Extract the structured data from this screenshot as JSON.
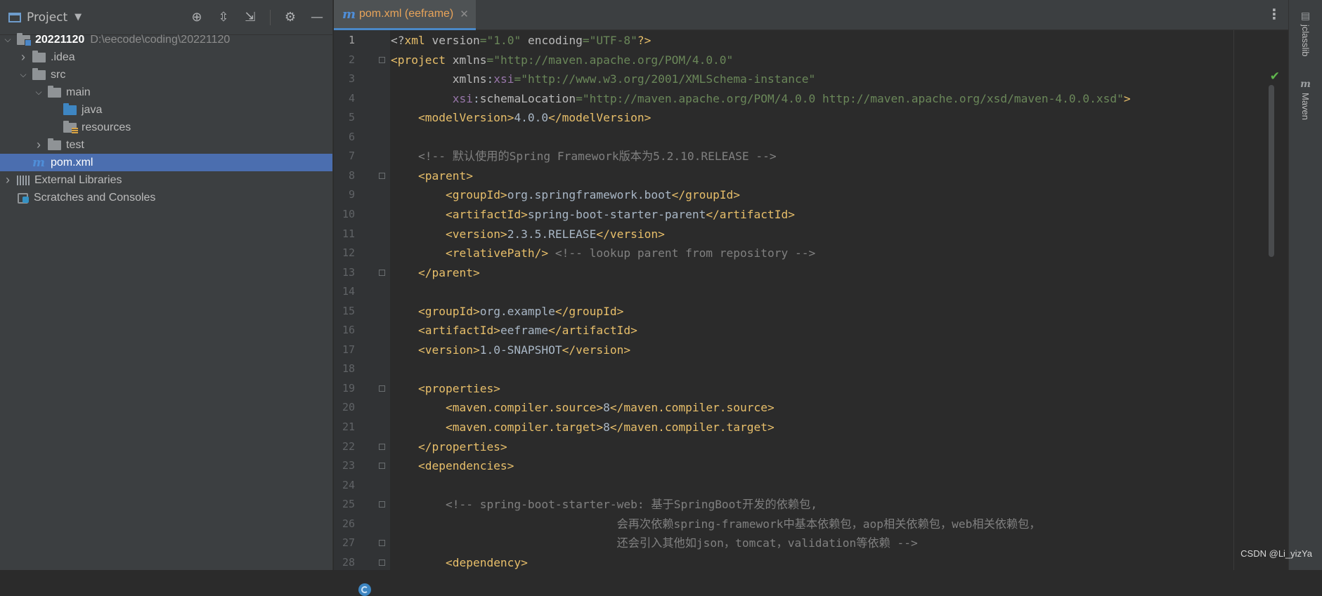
{
  "project_panel": {
    "title": "Project",
    "tree": [
      {
        "label": "20221120",
        "hint": "D:\\eecode\\coding\\20221120",
        "depth": 0,
        "expanded": true,
        "icon": "module-folder-icon"
      },
      {
        "label": ".idea",
        "depth": 1,
        "expanded": false,
        "icon": "folder-icon"
      },
      {
        "label": "src",
        "depth": 1,
        "expanded": true,
        "icon": "folder-icon"
      },
      {
        "label": "main",
        "depth": 2,
        "expanded": true,
        "icon": "folder-icon"
      },
      {
        "label": "java",
        "depth": 3,
        "expanded": null,
        "icon": "source-folder-icon"
      },
      {
        "label": "resources",
        "depth": 3,
        "expanded": null,
        "icon": "resources-folder-icon"
      },
      {
        "label": "test",
        "depth": 2,
        "expanded": false,
        "icon": "folder-icon"
      },
      {
        "label": "pom.xml",
        "depth": 1,
        "expanded": null,
        "icon": "maven-icon",
        "selected": true
      },
      {
        "label": "External Libraries",
        "depth": 0,
        "expanded": false,
        "icon": "library-icon"
      },
      {
        "label": "Scratches and Consoles",
        "depth": 0,
        "expanded": null,
        "icon": "scratches-icon"
      }
    ]
  },
  "editor": {
    "tab_label": "pom.xml (eeframe)",
    "current_line": 1,
    "line_numbers": [
      "1",
      "2",
      "3",
      "4",
      "5",
      "6",
      "7",
      "8",
      "9",
      "10",
      "11",
      "12",
      "13",
      "14",
      "15",
      "16",
      "17",
      "18",
      "19",
      "20",
      "21",
      "22",
      "23",
      "24",
      "25",
      "26",
      "27",
      "28"
    ],
    "code": [
      [
        [
          "b",
          "<?"
        ],
        [
          "tag",
          "xml "
        ],
        [
          "attr",
          "version"
        ],
        [
          "val",
          "=\"1.0\" "
        ],
        [
          "attr",
          "encoding"
        ],
        [
          "val",
          "=\"UTF-8\""
        ],
        [
          "tag",
          "?>"
        ]
      ],
      [
        [
          "tag",
          "<project "
        ],
        [
          "attr",
          "xmlns"
        ],
        [
          "val",
          "=\"http://maven.apache.org/POM/4.0.0\""
        ]
      ],
      [
        [
          "txt",
          "         "
        ],
        [
          "attr",
          "xmlns"
        ],
        [
          "txt",
          ":"
        ],
        [
          "ns",
          "xsi"
        ],
        [
          "val",
          "=\"http://www.w3.org/2001/XMLSchema-instance\""
        ]
      ],
      [
        [
          "txt",
          "         "
        ],
        [
          "ns",
          "xsi"
        ],
        [
          "txt",
          ":"
        ],
        [
          "attr",
          "schemaLocation"
        ],
        [
          "val",
          "=\"http://maven.apache.org/POM/4.0.0 http://maven.apache.org/xsd/maven-4.0.0.xsd\""
        ],
        [
          "tag",
          ">"
        ]
      ],
      [
        [
          "txt",
          "    "
        ],
        [
          "tag",
          "<modelVersion>"
        ],
        [
          "txt",
          "4.0.0"
        ],
        [
          "tag",
          "</modelVersion>"
        ]
      ],
      [],
      [
        [
          "txt",
          "    "
        ],
        [
          "cmt",
          "<!-- 默认使用的Spring Framework版本为5.2.10.RELEASE -->"
        ]
      ],
      [
        [
          "txt",
          "    "
        ],
        [
          "tag",
          "<parent>"
        ]
      ],
      [
        [
          "txt",
          "        "
        ],
        [
          "tag",
          "<groupId>"
        ],
        [
          "txt",
          "org.springframework.boot"
        ],
        [
          "tag",
          "</groupId>"
        ]
      ],
      [
        [
          "txt",
          "        "
        ],
        [
          "tag",
          "<artifactId>"
        ],
        [
          "txt",
          "spring-boot-starter-parent"
        ],
        [
          "tag",
          "</artifactId>"
        ]
      ],
      [
        [
          "txt",
          "        "
        ],
        [
          "tag",
          "<version>"
        ],
        [
          "txt",
          "2.3.5.RELEASE"
        ],
        [
          "tag",
          "</version>"
        ]
      ],
      [
        [
          "txt",
          "        "
        ],
        [
          "tag",
          "<relativePath/>"
        ],
        [
          "txt",
          " "
        ],
        [
          "cmt",
          "<!-- lookup parent from repository -->"
        ]
      ],
      [
        [
          "txt",
          "    "
        ],
        [
          "tag",
          "</parent>"
        ]
      ],
      [],
      [
        [
          "txt",
          "    "
        ],
        [
          "tag",
          "<groupId>"
        ],
        [
          "txt",
          "org.example"
        ],
        [
          "tag",
          "</groupId>"
        ]
      ],
      [
        [
          "txt",
          "    "
        ],
        [
          "tag",
          "<artifactId>"
        ],
        [
          "txt",
          "eeframe"
        ],
        [
          "tag",
          "</artifactId>"
        ]
      ],
      [
        [
          "txt",
          "    "
        ],
        [
          "tag",
          "<version>"
        ],
        [
          "txt",
          "1.0-SNAPSHOT"
        ],
        [
          "tag",
          "</version>"
        ]
      ],
      [],
      [
        [
          "txt",
          "    "
        ],
        [
          "tag",
          "<properties>"
        ]
      ],
      [
        [
          "txt",
          "        "
        ],
        [
          "tag",
          "<maven.compiler.source>"
        ],
        [
          "txt",
          "8"
        ],
        [
          "tag",
          "</maven.compiler.source>"
        ]
      ],
      [
        [
          "txt",
          "        "
        ],
        [
          "tag",
          "<maven.compiler.target>"
        ],
        [
          "txt",
          "8"
        ],
        [
          "tag",
          "</maven.compiler.target>"
        ]
      ],
      [
        [
          "txt",
          "    "
        ],
        [
          "tag",
          "</properties>"
        ]
      ],
      [
        [
          "txt",
          "    "
        ],
        [
          "tag",
          "<dependencies>"
        ]
      ],
      [],
      [
        [
          "txt",
          "        "
        ],
        [
          "cmt",
          "<!-- spring-boot-starter-web: 基于SpringBoot开发的依赖包,"
        ]
      ],
      [
        [
          "txt",
          "                                 "
        ],
        [
          "cmt",
          "会再次依赖spring-framework中基本依赖包，aop相关依赖包，web相关依赖包，"
        ]
      ],
      [
        [
          "txt",
          "                                 "
        ],
        [
          "cmt",
          "还会引入其他如json，tomcat，validation等依赖 -->"
        ]
      ],
      [
        [
          "txt",
          "        "
        ],
        [
          "tag",
          "<dependency>"
        ]
      ]
    ]
  },
  "right_strip": {
    "items": [
      {
        "label": "jclasslib",
        "icon": "jclasslib-icon"
      },
      {
        "label": "Maven",
        "icon": "maven-strip-icon"
      }
    ]
  },
  "watermark": "CSDN @Li_yizYa",
  "colors": {
    "tag": "#e8bf6a",
    "attribute": "#bababa",
    "namespace": "#9876aa",
    "string": "#6a8759",
    "comment": "#808080",
    "selection": "#4b6eaf"
  }
}
